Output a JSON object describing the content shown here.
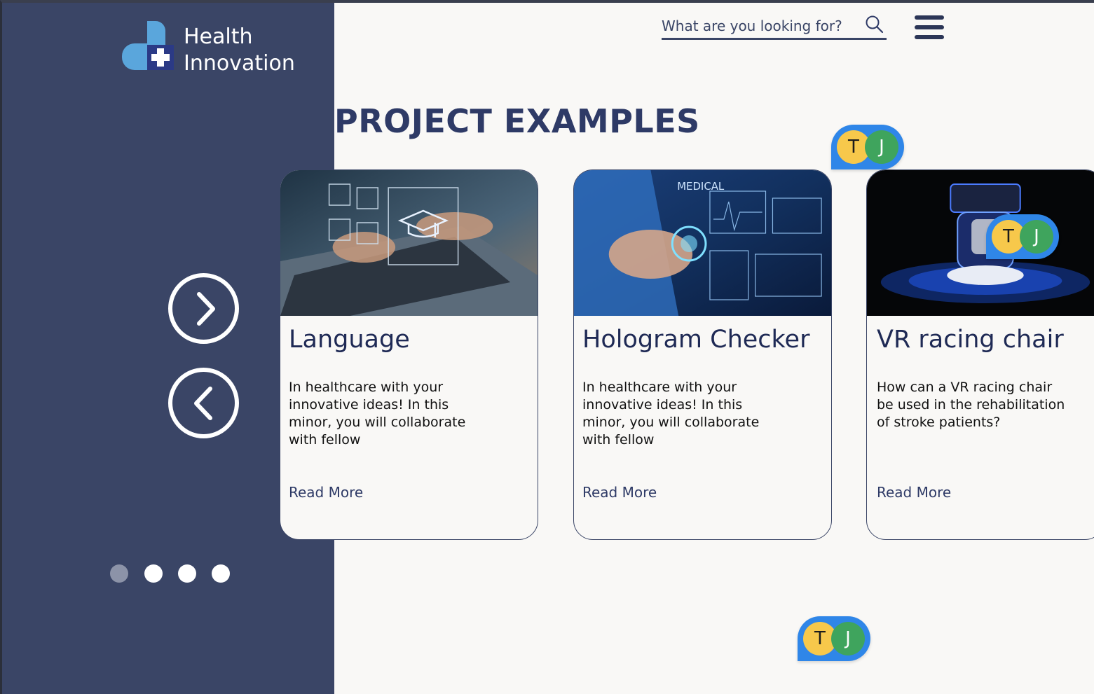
{
  "brand": {
    "name_line1": "Health",
    "name_line2": "Innovation"
  },
  "colors": {
    "sidebar": "#3a4566",
    "heading": "#2e3a66",
    "collab_bubble": "#2f86e8",
    "avatar_t": "#f7c84b",
    "avatar_j": "#3fa45d"
  },
  "header": {
    "search_placeholder": "What are you looking for?",
    "search_icon": "search-icon",
    "menu_icon": "hamburger-menu-icon"
  },
  "page": {
    "title": "PROJECT EXAMPLES"
  },
  "carousel": {
    "next_icon": "chevron-right-icon",
    "prev_icon": "chevron-left-icon",
    "page_count": 4,
    "active_page": 1
  },
  "cards": [
    {
      "title": "Language",
      "description": "In healthcare with your innovative ideas! In this minor, you will collaborate with fellow",
      "link": "Read More"
    },
    {
      "title": "Hologram Checker",
      "description": "In healthcare with your innovative ideas! In this minor, you will collaborate with fellow",
      "link": "Read More",
      "image_text": "MEDICAL"
    },
    {
      "title": "VR racing chair",
      "description": "How can a VR racing chair be used in the rehabilitation of stroke patients?",
      "link": "Read More"
    }
  ],
  "collaborators": [
    {
      "initial": "T"
    },
    {
      "initial": "J"
    }
  ]
}
